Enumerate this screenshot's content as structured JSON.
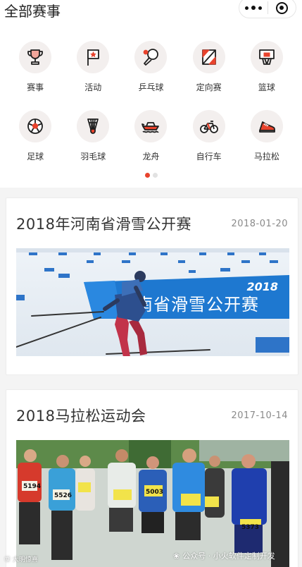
{
  "header": {
    "title": "全部赛事"
  },
  "categories": [
    {
      "label": "赛事",
      "icon": "trophy-icon"
    },
    {
      "label": "活动",
      "icon": "flag-icon"
    },
    {
      "label": "乒乓球",
      "icon": "ping-pong-icon"
    },
    {
      "label": "定向赛",
      "icon": "orienteering-map-icon"
    },
    {
      "label": "篮球",
      "icon": "basketball-hoop-icon"
    },
    {
      "label": "足球",
      "icon": "football-icon"
    },
    {
      "label": "羽毛球",
      "icon": "shuttlecock-icon"
    },
    {
      "label": "龙舟",
      "icon": "dragon-boat-icon"
    },
    {
      "label": "自行车",
      "icon": "bicycle-icon"
    },
    {
      "label": "马拉松",
      "icon": "running-shoe-icon"
    }
  ],
  "pager": {
    "pages": 2,
    "active": 1
  },
  "events": [
    {
      "title": "2018年河南省滑雪公开赛",
      "date": "2018-01-20",
      "banner_year": "2018",
      "banner_text": "河南省滑雪公开赛"
    },
    {
      "title": "2018马拉松运动会",
      "date": "2017-10-14",
      "bibs": [
        "5194",
        "5526",
        "5003",
        "5373"
      ]
    }
  ],
  "watermark": {
    "text": "公众号 · 小火软件定制开发",
    "left_text": "⑫ 大明惊喜"
  },
  "colors": {
    "accent": "#e8432d",
    "icon_stroke": "#1f1f1f",
    "icon_bg": "#f3efee",
    "banner_blue": "#1e78d0"
  }
}
